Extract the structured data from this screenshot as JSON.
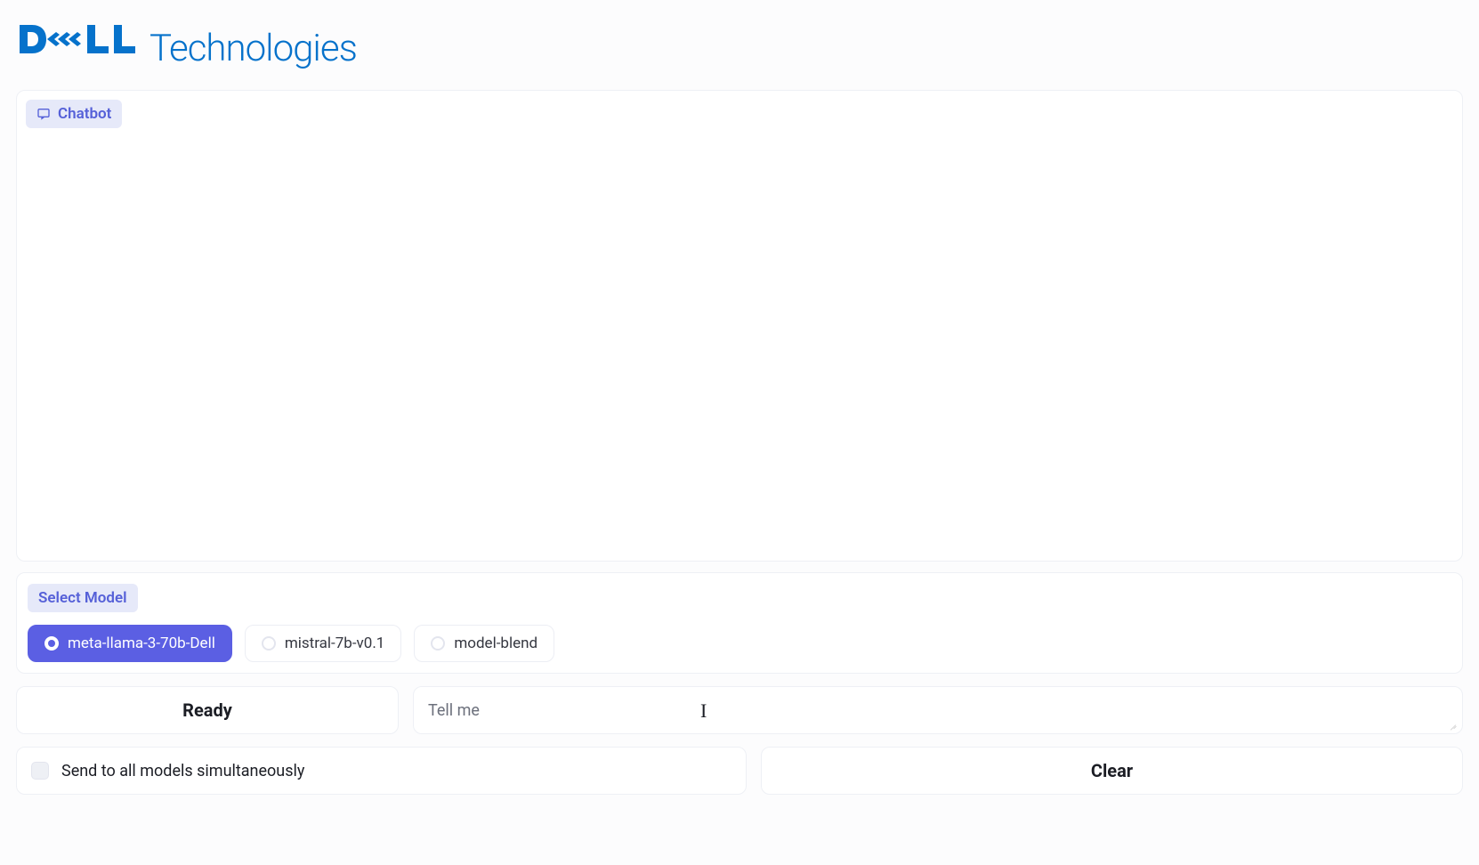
{
  "logo": {
    "brand": "DELL",
    "suffix": "Technologies"
  },
  "chat": {
    "label": "Chatbot"
  },
  "models": {
    "label": "Select Model",
    "options": [
      {
        "id": "meta-llama-3-70b-Dell",
        "label": "meta-llama-3-70b-Dell",
        "selected": true
      },
      {
        "id": "mistral-7b-v0.1",
        "label": "mistral-7b-v0.1",
        "selected": false
      },
      {
        "id": "model-blend",
        "label": "model-blend",
        "selected": false
      }
    ]
  },
  "status": {
    "label": "Ready"
  },
  "prompt": {
    "value": "Tell me"
  },
  "broadcast": {
    "label": "Send to all models simultaneously",
    "checked": false
  },
  "actions": {
    "clear": "Clear"
  }
}
